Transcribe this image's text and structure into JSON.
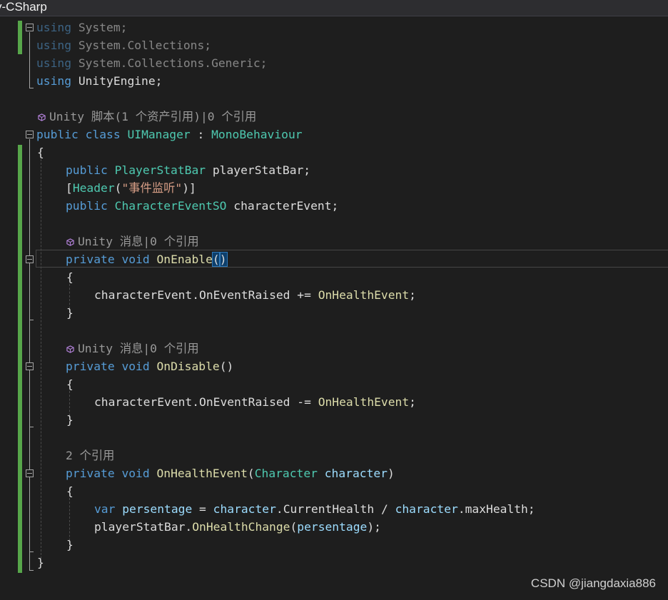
{
  "tab": {
    "title": "y-CSharp"
  },
  "code": {
    "using1": {
      "kw": "using",
      "ns": "System;"
    },
    "using2": {
      "kw": "using",
      "ns": "System.Collections;"
    },
    "using3": {
      "kw": "using",
      "ns": "System.Collections.Generic;"
    },
    "using4": {
      "kw": "using",
      "ns": "UnityEngine;"
    },
    "lens_class": "Unity 脚本(1 个资产引用)|0 个引用",
    "class_decl": {
      "k1": "public",
      "k2": "class",
      "name": "UIManager",
      "colon": " : ",
      "base": "MonoBehaviour"
    },
    "brace_open": "{",
    "brace_close": "}",
    "field1": {
      "k": "public",
      "type": "PlayerStatBar",
      "name": " playerStatBar;"
    },
    "attr": {
      "open": "[",
      "name": "Header",
      "paren_open": "(",
      "str": "\"事件监听\"",
      "paren_close": ")",
      "close": "]"
    },
    "field2": {
      "k": "public",
      "type": "CharacterEventSO",
      "name": " characterEvent;"
    },
    "lens_enable": "Unity 消息|0 个引用",
    "enable_decl": {
      "k1": "private",
      "k2": "void",
      "name": "OnEnable",
      "open": "(",
      "close": ")"
    },
    "enable_body": {
      "obj": "characterEvent.",
      "evt": "OnEventRaised",
      "op": " += ",
      "handler": "OnHealthEvent",
      "end": ";"
    },
    "lens_disable": "Unity 消息|0 个引用",
    "disable_decl": {
      "k1": "private",
      "k2": "void",
      "name": "OnDisable",
      "parens": "()"
    },
    "disable_body": {
      "obj": "characterEvent.",
      "evt": "OnEventRaised",
      "op": " -= ",
      "handler": "OnHealthEvent",
      "end": ";"
    },
    "lens_health": "2 个引用",
    "health_decl": {
      "k1": "private",
      "k2": "void",
      "name": "OnHealthEvent",
      "open": "(",
      "ptype": "Character",
      "pname": " character",
      "close": ")"
    },
    "health_l1": {
      "k": "var",
      "v": " persentage",
      "eq": " = ",
      "a": "character",
      "dot1": ".",
      "b": "CurrentHealth",
      "div": " / ",
      "c": "character",
      "dot2": ".",
      "d": "maxHealth",
      "end": ";"
    },
    "health_l2": {
      "obj": "playerStatBar.",
      "fn": "OnHealthChange",
      "open": "(",
      "arg": "persentage",
      "close": ");"
    }
  },
  "watermark": "CSDN @jiangdaxia886",
  "colors": {
    "keyword": "#569cd6",
    "type": "#4ec9b0",
    "method": "#dcdcaa",
    "variable": "#9cdcfe",
    "string": "#d69d85",
    "change_bar": "#57a64a",
    "background": "#1e1e1e"
  }
}
